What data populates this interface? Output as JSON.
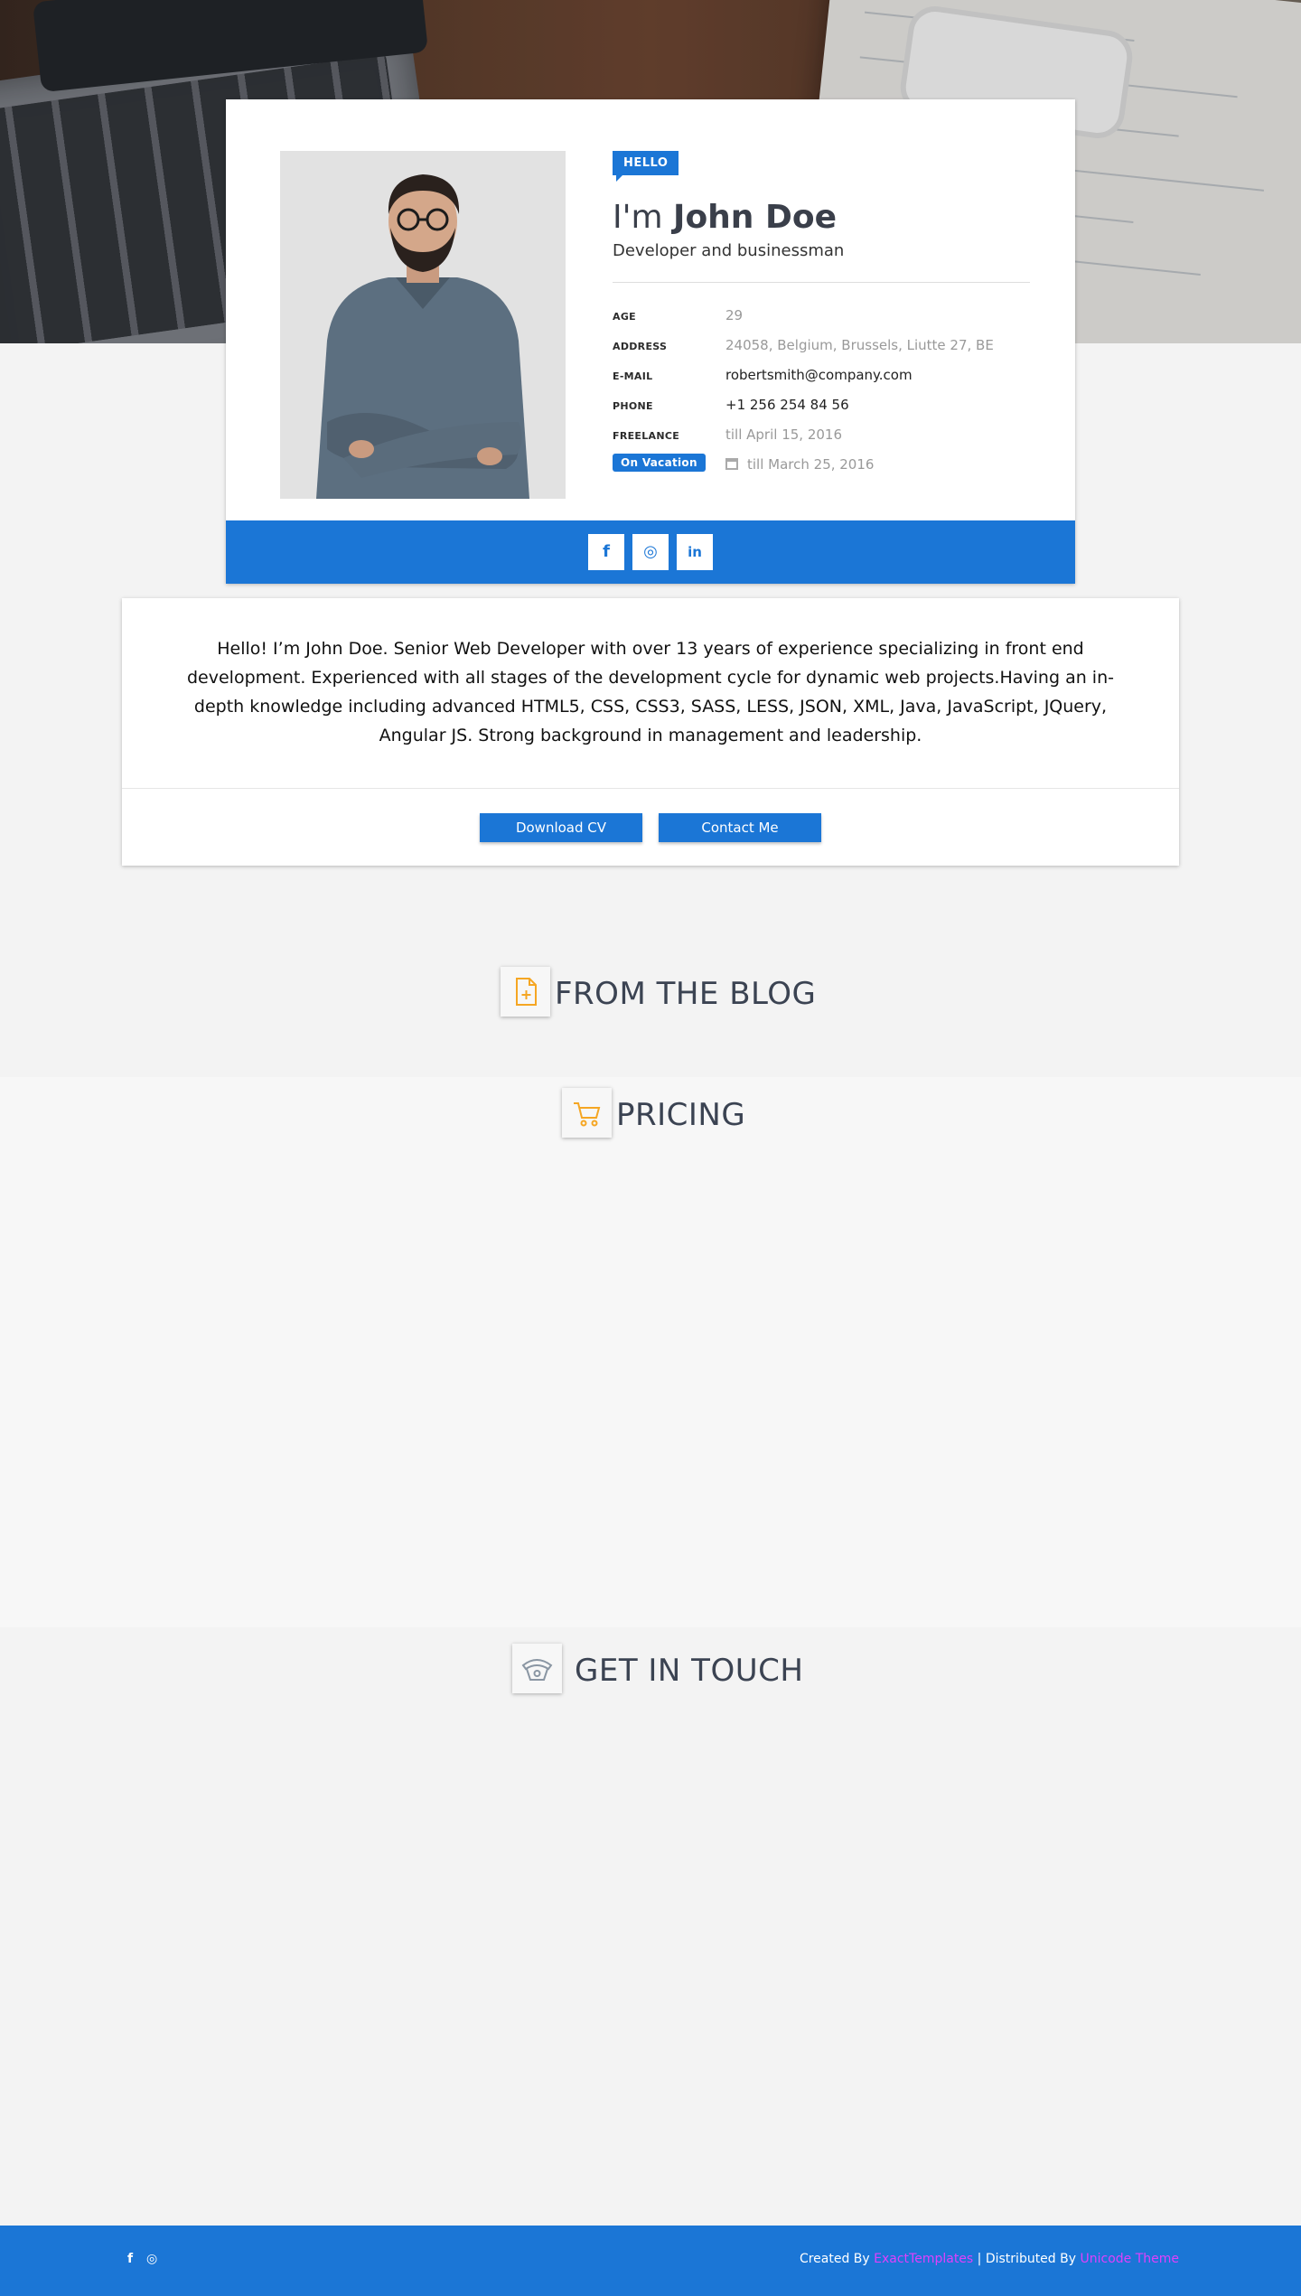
{
  "profile": {
    "badge": "HELLO",
    "greeting": "I'm",
    "name": "John Doe",
    "role": "Developer and businessman",
    "info": [
      {
        "label": "AGE",
        "value": "29"
      },
      {
        "label": "ADDRESS",
        "value": "24058, Belgium, Brussels, Liutte 27, BE"
      },
      {
        "label": "E-MAIL",
        "value": "robertsmith@company.com"
      },
      {
        "label": "PHONE",
        "value": "+1 256 254 84 56"
      },
      {
        "label": "FREELANCE",
        "value": "till April 15, 2016"
      }
    ],
    "vacation": {
      "badge": "On Vacation",
      "value": "till March 25, 2016"
    },
    "social": {
      "facebook": "f",
      "instagram": "◎",
      "linkedin": "in"
    }
  },
  "bio": {
    "text": "Hello! I’m John Doe. Senior Web Developer with over 13 years of experience specializing in front end development. Experienced with all stages of the development cycle for dynamic web projects.Having an in-depth knowledge including advanced HTML5, CSS, CSS3, SASS, LESS, JSON, XML, Java, JavaScript, JQuery, Angular JS. Strong background in management and leadership.",
    "download_label": "Download CV",
    "contact_label": "Contact Me"
  },
  "sections": {
    "blog": "FROM THE BLOG",
    "pricing": "PRICING",
    "contact": "GET IN TOUCH"
  },
  "footer": {
    "facebook": "f",
    "instagram": "◎",
    "created_by": "Created By",
    "created_by_link": "ExactTemplates",
    "distributed_by": "| Distributed By",
    "distributed_by_link": "Unicode Theme"
  },
  "colors": {
    "accent": "#1b76d6",
    "icon": "#f5a623",
    "footer_link": "#e040fb"
  }
}
